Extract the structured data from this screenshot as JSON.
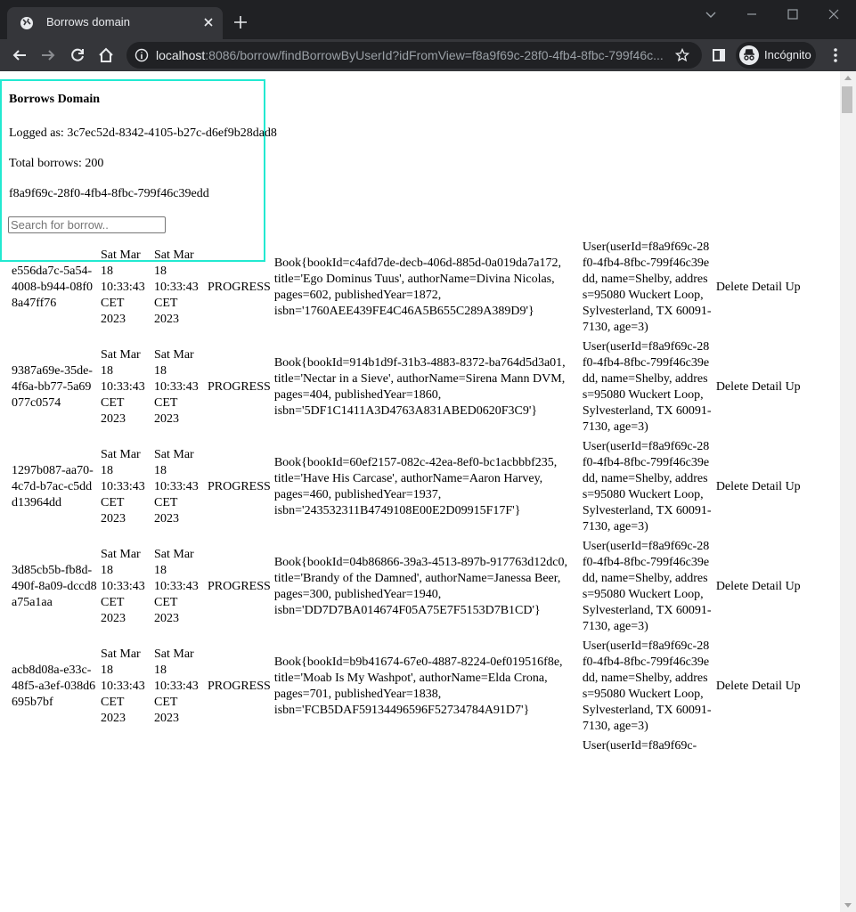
{
  "browser": {
    "tab_title": "Borrows domain",
    "url_host": "localhost",
    "url_rest": ":8086/borrow/findBorrowByUserId?idFromView=f8a9f69c-28f0-4fb4-8fbc-799f46c...",
    "incognito_label": "Incógnito"
  },
  "page": {
    "heading": "Borrows Domain",
    "logged_as": "Logged as: 3c7ec52d-8342-4105-b27c-d6ef9b28dad8",
    "total": "Total borrows: 200",
    "user_id": "f8a9f69c-28f0-4fb4-8fbc-799f46c39edd",
    "search_placeholder": "Search for borrow.."
  },
  "actions": {
    "delete": "Delete",
    "detail": "Detail",
    "update": "Up"
  },
  "rows": [
    {
      "id": "e556da7c-5a54-4008-b944-08f08a47ff76",
      "start": "Sat Mar 18 10:33:43 CET 2023",
      "end": "Sat Mar 18 10:33:43 CET 2023",
      "status": "PROGRESS",
      "book": "Book{bookId=c4afd7de-decb-406d-885d-0a019da7a172, title='Ego Dominus Tuus', authorName=Divina Nicolas, pages=602, publishedYear=1872, isbn='1760AEE439FE4C46A5B655C289A389D9'}",
      "user": "User(userId=f8a9f69c-28f0-4fb4-8fbc-799f46c39edd, name=Shelby, address=95080 Wuckert Loop, Sylvesterland, TX 60091-7130, age=3)"
    },
    {
      "id": "9387a69e-35de-4f6a-bb77-5a69077c0574",
      "start": "Sat Mar 18 10:33:43 CET 2023",
      "end": "Sat Mar 18 10:33:43 CET 2023",
      "status": "PROGRESS",
      "book": "Book{bookId=914b1d9f-31b3-4883-8372-ba764d5d3a01, title='Nectar in a Sieve', authorName=Sirena Mann DVM, pages=404, publishedYear=1860, isbn='5DF1C1411A3D4763A831ABED0620F3C9'}",
      "user": "User(userId=f8a9f69c-28f0-4fb4-8fbc-799f46c39edd, name=Shelby, address=95080 Wuckert Loop, Sylvesterland, TX 60091-7130, age=3)"
    },
    {
      "id": "1297b087-aa70-4c7d-b7ac-c5ddd13964dd",
      "start": "Sat Mar 18 10:33:43 CET 2023",
      "end": "Sat Mar 18 10:33:43 CET 2023",
      "status": "PROGRESS",
      "book": "Book{bookId=60ef2157-082c-42ea-8ef0-bc1acbbbf235, title='Have His Carcase', authorName=Aaron Harvey, pages=460, publishedYear=1937, isbn='243532311B4749108E00E2D09915F17F'}",
      "user": "User(userId=f8a9f69c-28f0-4fb4-8fbc-799f46c39edd, name=Shelby, address=95080 Wuckert Loop, Sylvesterland, TX 60091-7130, age=3)"
    },
    {
      "id": "3d85cb5b-fb8d-490f-8a09-dccd8a75a1aa",
      "start": "Sat Mar 18 10:33:43 CET 2023",
      "end": "Sat Mar 18 10:33:43 CET 2023",
      "status": "PROGRESS",
      "book": "Book{bookId=04b86866-39a3-4513-897b-917763d12dc0, title='Brandy of the Damned', authorName=Janessa Beer, pages=300, publishedYear=1940, isbn='DD7D7BA014674F05A75E7F5153D7B1CD'}",
      "user": "User(userId=f8a9f69c-28f0-4fb4-8fbc-799f46c39edd, name=Shelby, address=95080 Wuckert Loop, Sylvesterland, TX 60091-7130, age=3)"
    },
    {
      "id": "acb8d08a-e33c-48f5-a3ef-038d6695b7bf",
      "start": "Sat Mar 18 10:33:43 CET 2023",
      "end": "Sat Mar 18 10:33:43 CET 2023",
      "status": "PROGRESS",
      "book": "Book{bookId=b9b41674-67e0-4887-8224-0ef019516f8e, title='Moab Is My Washpot', authorName=Elda Crona, pages=701, publishedYear=1838, isbn='FCB5DAF59134496596F52734784A91D7'}",
      "user": "User(userId=f8a9f69c-28f0-4fb4-8fbc-799f46c39edd, name=Shelby, address=95080 Wuckert Loop, Sylvesterland, TX 60091-7130, age=3)"
    },
    {
      "id": "",
      "start": "",
      "end": "",
      "status": "",
      "book": "",
      "user": "User(userId=f8a9f69c-"
    }
  ]
}
